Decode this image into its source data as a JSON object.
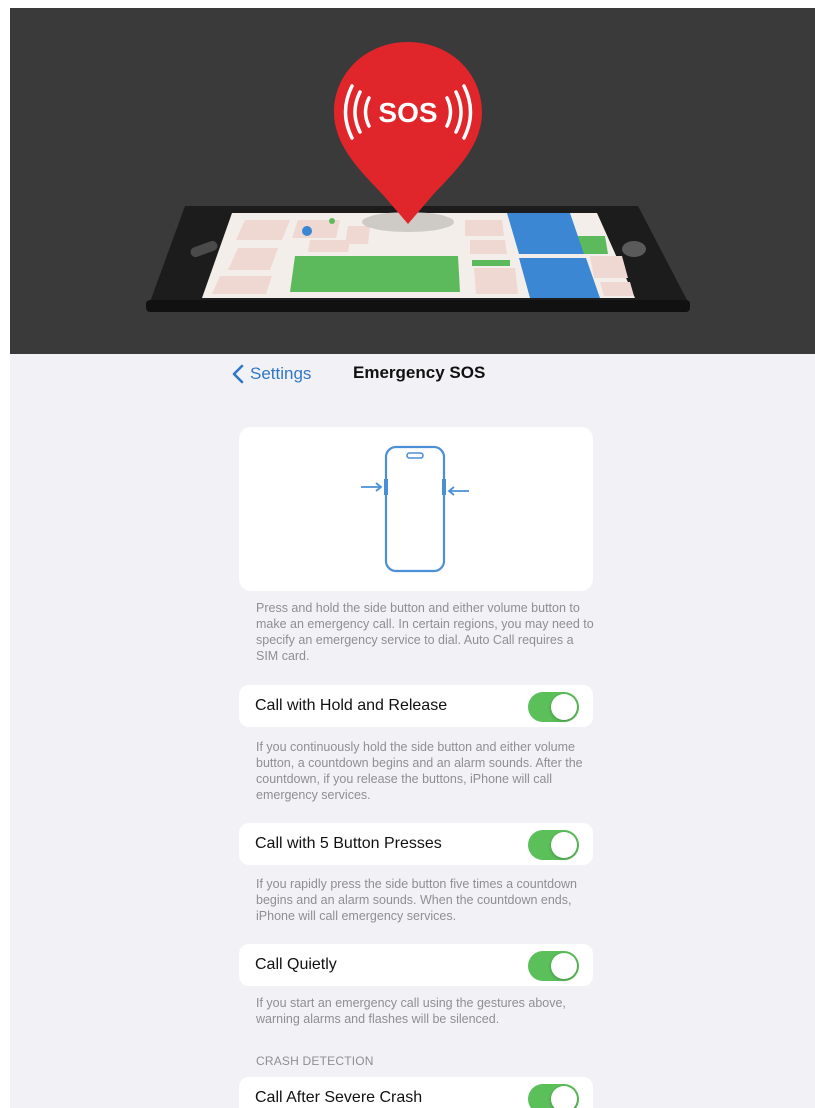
{
  "hero": {
    "badge_text": "SOS",
    "pin_color": "#e0262b",
    "background_color": "#3a3a3a"
  },
  "nav": {
    "back_label": "Settings",
    "title": "Emergency SOS",
    "back_icon": "chevron-left-icon"
  },
  "intro": {
    "illustration_icon": "phone-side-buttons-icon",
    "description": "Press and hold the side button and either volume button to make an emergency call. In certain regions, you may need to specify an emergency service to dial. Auto Call requires a SIM card."
  },
  "settings": [
    {
      "label": "Call with Hold and Release",
      "enabled": true,
      "description": "If you continuously hold the side button and either volume button, a countdown begins and an alarm sounds. After the countdown, if you release the buttons, iPhone will call emergency services."
    },
    {
      "label": "Call with 5 Button Presses",
      "enabled": true,
      "description": "If you rapidly press the side button five times a countdown begins and an alarm sounds. When the countdown ends, iPhone will call emergency services."
    },
    {
      "label": "Call Quietly",
      "enabled": true,
      "description": "If you start an emergency call using the gestures above, warning alarms and flashes will be silenced."
    }
  ],
  "crash_detection": {
    "header": "CRASH DETECTION",
    "items": [
      {
        "label": "Call After Severe Crash",
        "enabled": true
      }
    ]
  },
  "colors": {
    "accent": "#2f78c8",
    "toggle_on": "#5bbf5a",
    "background": "#f2f2f6"
  }
}
